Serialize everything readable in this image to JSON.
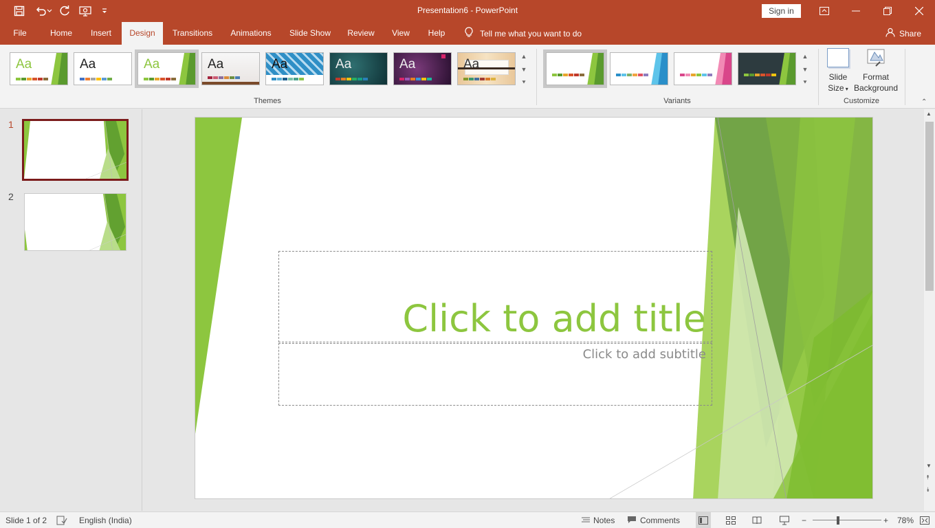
{
  "titlebar": {
    "title": "Presentation6  -  PowerPoint",
    "signin": "Sign in",
    "qat_icons": [
      "save-icon",
      "undo-icon",
      "redo-icon",
      "present-from-start-icon",
      "customize-qat-icon"
    ],
    "window_icons": [
      "ribbon-display-options-icon",
      "minimize-icon",
      "restore-icon",
      "close-icon"
    ]
  },
  "tabs": [
    {
      "label": "File"
    },
    {
      "label": "Home"
    },
    {
      "label": "Insert"
    },
    {
      "label": "Design"
    },
    {
      "label": "Transitions"
    },
    {
      "label": "Animations"
    },
    {
      "label": "Slide Show"
    },
    {
      "label": "Review"
    },
    {
      "label": "View"
    },
    {
      "label": "Help"
    }
  ],
  "active_tab": "Design",
  "tell_me": "Tell me what you want to do",
  "share": "Share",
  "ribbon": {
    "groups": {
      "themes": "Themes",
      "variants": "Variants",
      "customize": "Customize"
    },
    "theme_preview_text": "Aa",
    "slide_size": {
      "line1": "Slide",
      "line2": "Size"
    },
    "format_background": {
      "line1": "Format",
      "line2": "Background"
    }
  },
  "slides": {
    "numbers": [
      "1",
      "2"
    ],
    "selected": "1"
  },
  "slide": {
    "title_placeholder": "Click to add title",
    "subtitle_placeholder": "Click to add subtitle"
  },
  "status": {
    "slide_of": "Slide 1 of 2",
    "language": "English (India)",
    "notes": "Notes",
    "comments": "Comments",
    "zoom": "78%"
  },
  "colors": {
    "accent": "#b7472a",
    "theme_green": "#8dc63f",
    "dark_green": "#5a9a2e"
  }
}
